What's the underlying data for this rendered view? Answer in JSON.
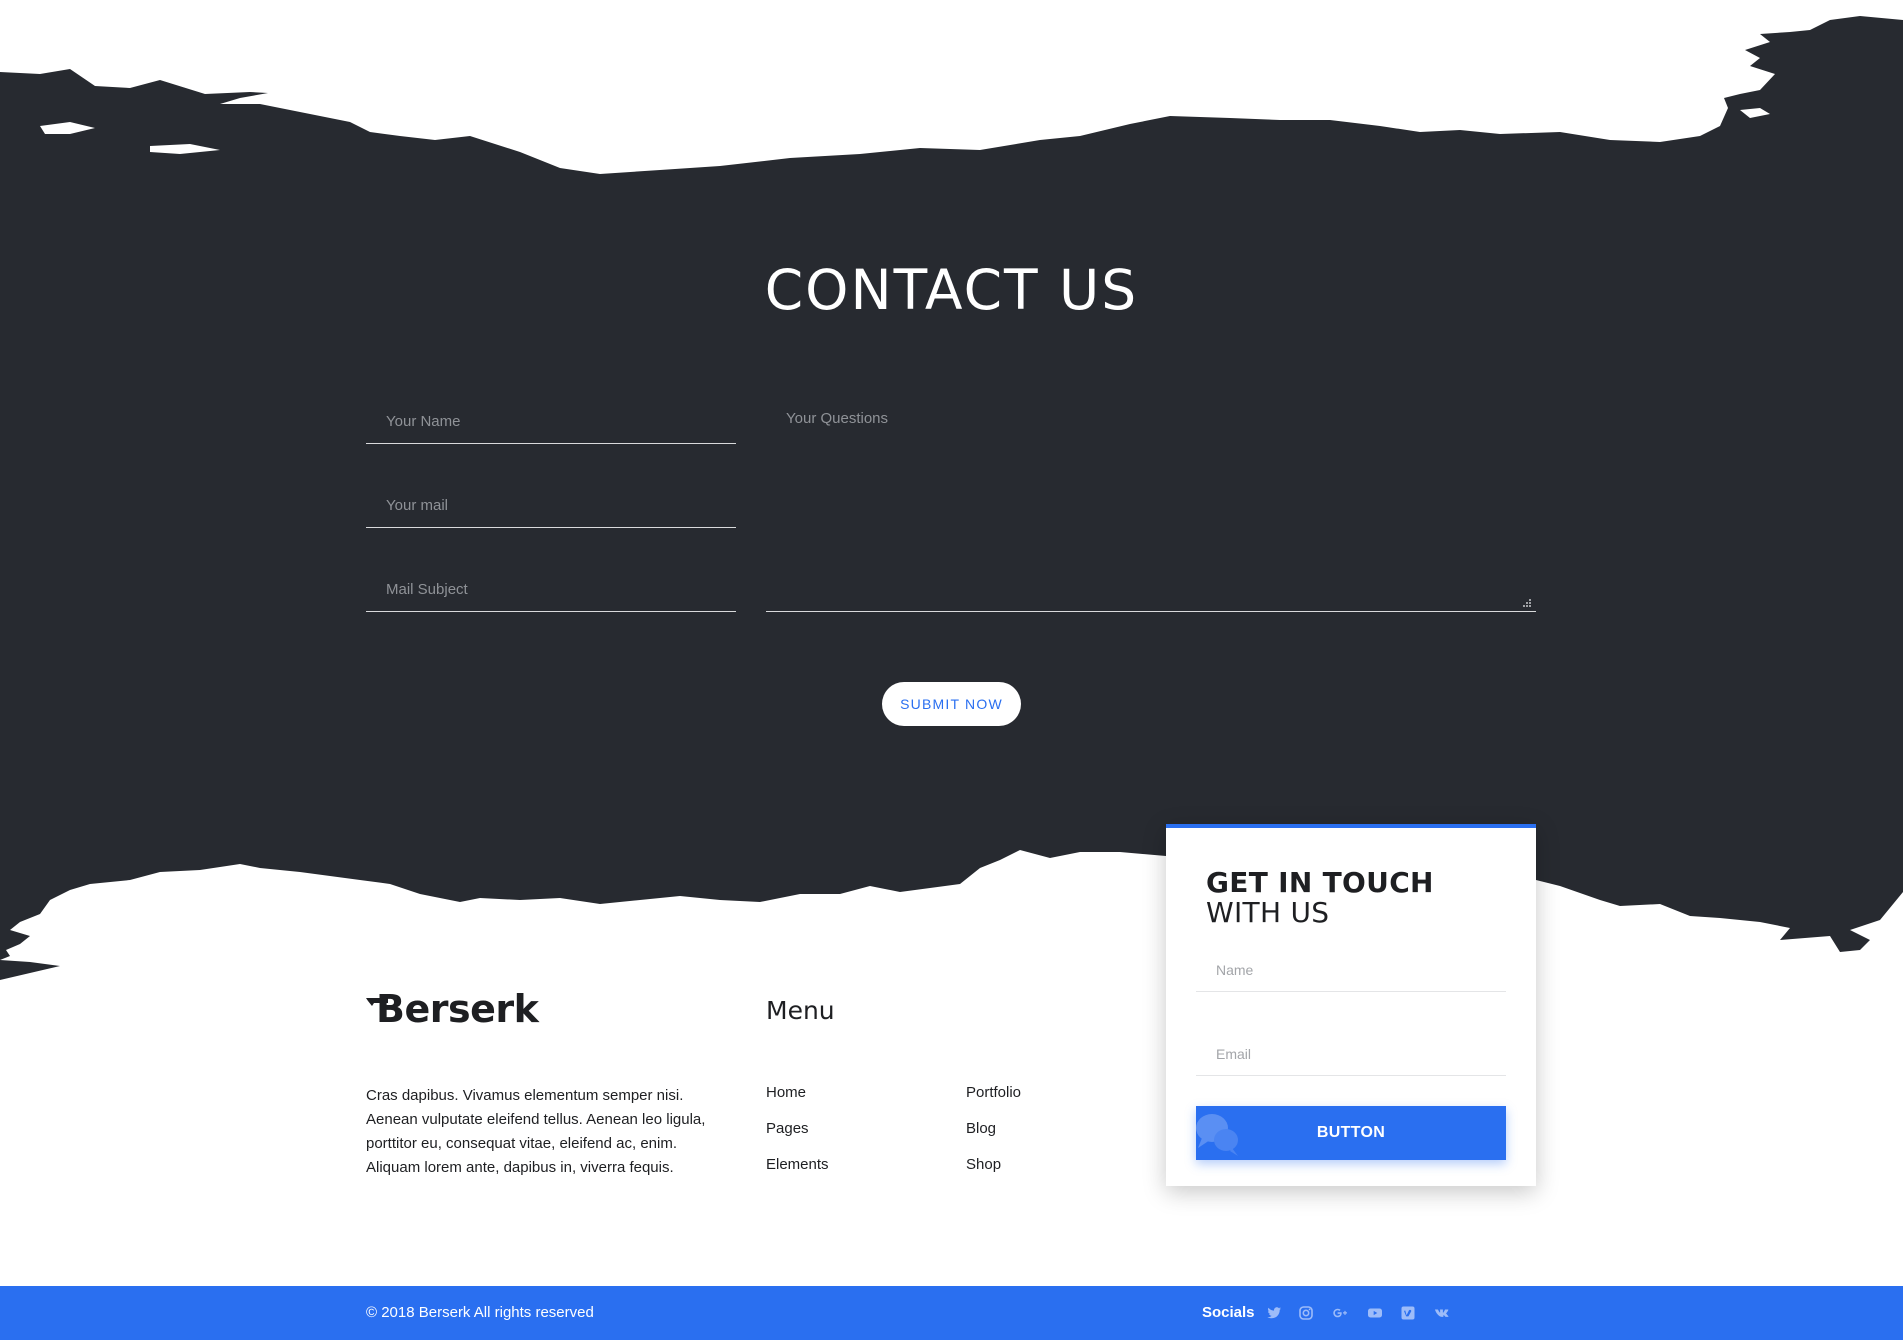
{
  "colors": {
    "dark_background": "#272a30",
    "accent": "#2a6ff0",
    "text_dark": "#1e1f22",
    "white": "#ffffff"
  },
  "contact": {
    "title": "CONTACT US",
    "name_placeholder": "Your Name",
    "mail_placeholder": "Your mail",
    "subject_placeholder": "Mail Subject",
    "questions_placeholder": "Your Questions",
    "submit_label": "SUBMIT NOW"
  },
  "footer": {
    "brand": "Berserk",
    "about": "Cras dapibus. Vivamus elementum semper nisi. Aenean vulputate eleifend tellus. Aenean leo ligula, porttitor eu, consequat vitae, eleifend ac, enim. Aliquam lorem ante, dapibus in, viverra fequis.",
    "menu_title": "Menu",
    "menu_items": [
      "Home",
      "Pages",
      "Elements",
      "Portfolio",
      "Blog",
      "Shop"
    ]
  },
  "get_in_touch": {
    "title_line1": "GET IN TOUCH",
    "title_line2": "WITH US",
    "name_placeholder": "Name",
    "email_placeholder": "Email",
    "button_label": "BUTTON",
    "button_icon": "chat-bubbles-icon"
  },
  "bottom_bar": {
    "copyright": "© 2018 Berserk All rights reserved",
    "socials_label": "Socials",
    "social_icons": [
      "twitter-icon",
      "instagram-icon",
      "google-plus-icon",
      "youtube-icon",
      "vimeo-icon",
      "vk-icon"
    ]
  }
}
